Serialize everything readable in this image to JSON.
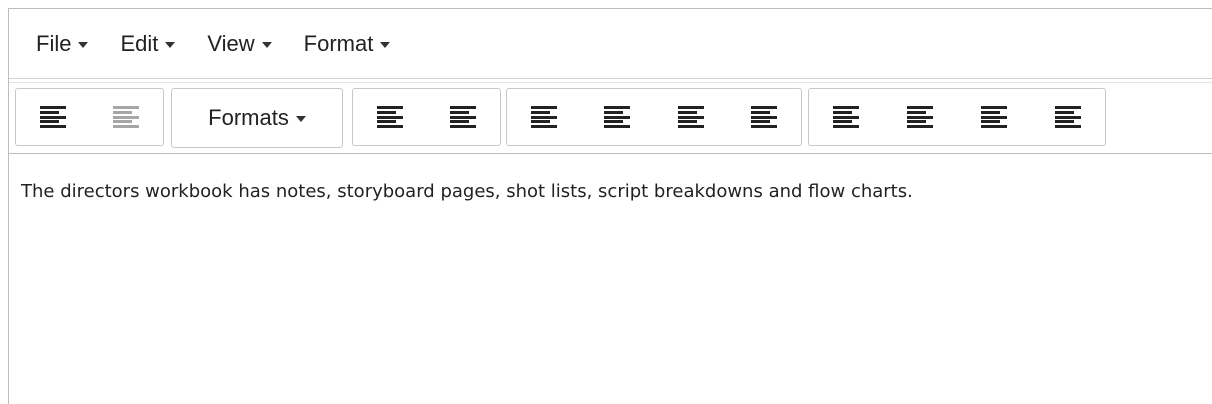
{
  "menubar": {
    "items": [
      {
        "label": "File"
      },
      {
        "label": "Edit"
      },
      {
        "label": "View"
      },
      {
        "label": "Format"
      }
    ]
  },
  "toolbar": {
    "formats_label": "Formats",
    "icons": {
      "align": "align-left-icon"
    }
  },
  "content": {
    "text": "The directors workbook has notes, storyboard pages, shot lists, script breakdowns and flow charts."
  }
}
